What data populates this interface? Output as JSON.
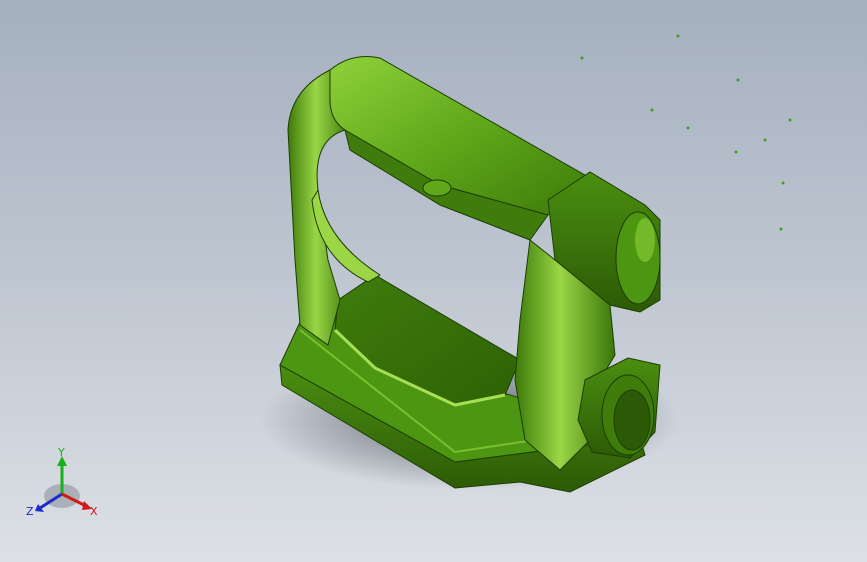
{
  "viewport": {
    "background_top": "#a5b0bf",
    "background_bottom": "#dde1e6"
  },
  "model": {
    "color": "#4e9a12",
    "highlight_color": "#8fd13a",
    "shadow_color": "#2c5a06",
    "edge_color": "#1e3d04"
  },
  "triad": {
    "y_label": "Y",
    "z_label": "Z",
    "x_label": "X",
    "y_color": "#19b019",
    "z_color": "#1a2bd0",
    "x_color": "#d01a1a"
  }
}
